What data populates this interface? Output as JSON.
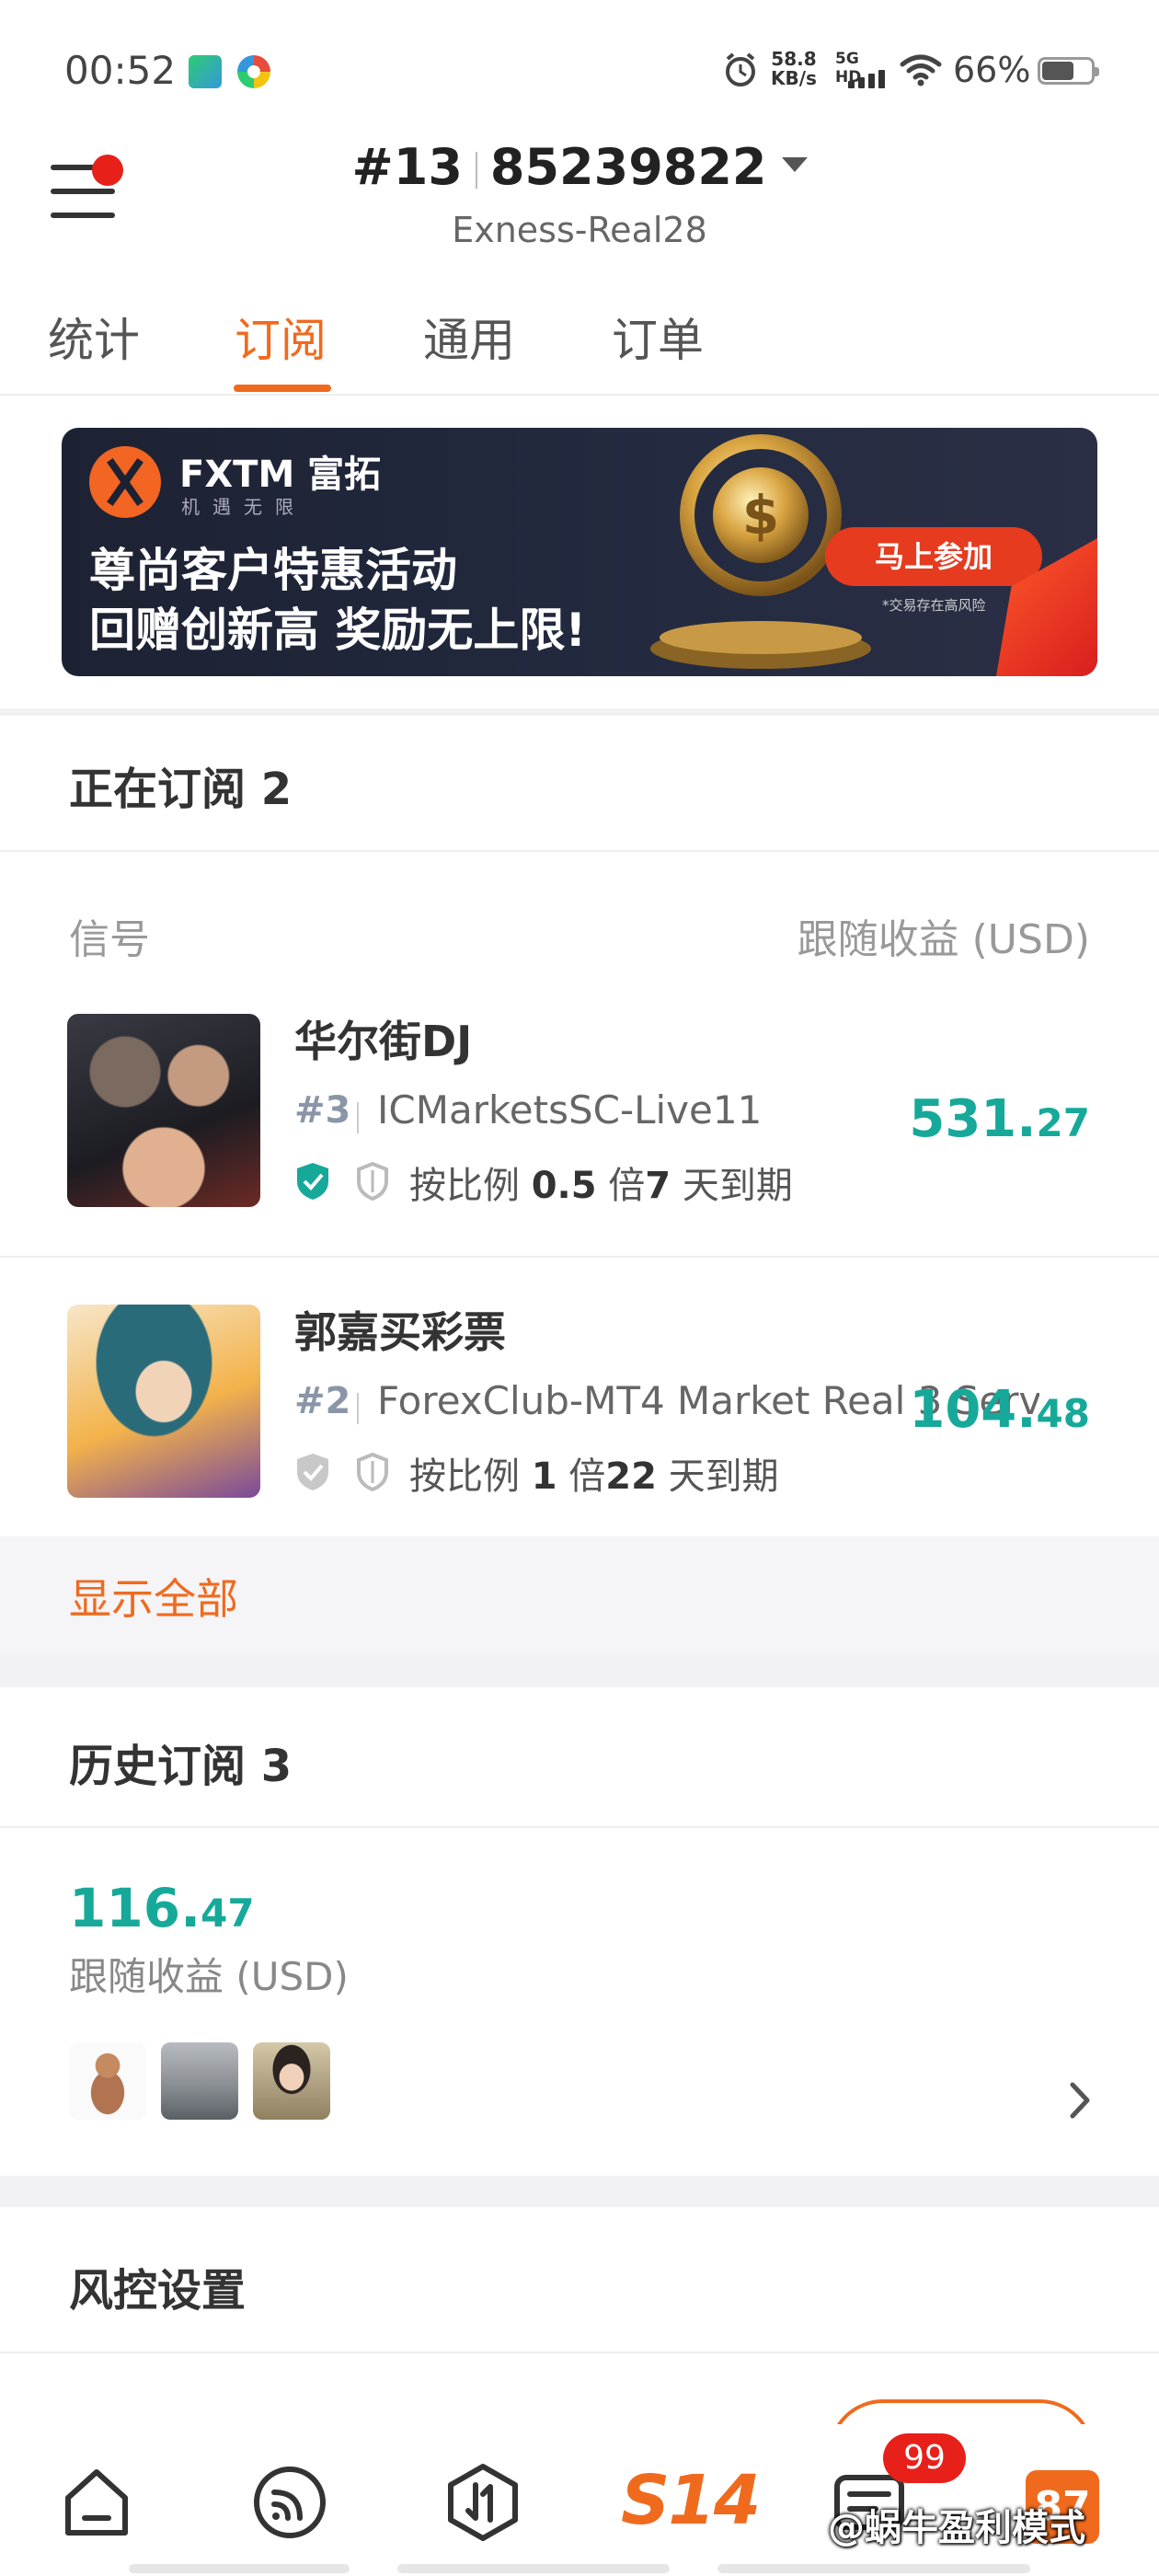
{
  "status_bar": {
    "time": "00:52",
    "net_speed_value": "58.8",
    "net_speed_unit": "KB/s",
    "network_type": "5G HD",
    "battery": "66%"
  },
  "header": {
    "account_rank": "#13",
    "account_number": "85239822",
    "server": "Exness-Real28"
  },
  "tabs": [
    {
      "label": "统计",
      "active": false
    },
    {
      "label": "订阅",
      "active": true
    },
    {
      "label": "通用",
      "active": false
    },
    {
      "label": "订单",
      "active": false
    }
  ],
  "banner": {
    "brand": "FXTM 富拓",
    "slogan": "机遇无限",
    "line1": "尊尚客户特惠活动",
    "line2": "回赠创新高 奖励无上限!",
    "cta": "马上参加",
    "risk_note": "*交易存在高风险"
  },
  "current_subscriptions": {
    "title": "正在订阅 2",
    "col_signal": "信号",
    "col_profit": "跟随收益 (USD)",
    "items": [
      {
        "name": "华尔街DJ",
        "rank": "#3",
        "broker": "ICMarketsSC-Live11",
        "profit_int": "531.",
        "profit_dec": "27",
        "ratio_prefix": "按比例 ",
        "ratio_value": "0.5",
        "ratio_suffix": " 倍",
        "days": "7",
        "days_suffix": " 天到期",
        "verified": true
      },
      {
        "name": "郭嘉买彩票",
        "rank": "#2",
        "broker": "ForexClub-MT4 Market Real 3 Server",
        "profit_int": "104.",
        "profit_dec": "48",
        "ratio_prefix": "按比例 ",
        "ratio_value": "1",
        "ratio_suffix": " 倍",
        "days": "22",
        "days_suffix": " 天到期",
        "verified": false
      }
    ],
    "show_all": "显示全部"
  },
  "history": {
    "title": "历史订阅 3",
    "profit_int": "116.",
    "profit_dec": "47",
    "profit_label": "跟随收益 (USD)"
  },
  "risk_settings": {
    "title": "风控设置"
  },
  "bottom_nav": {
    "s14_label": "S14",
    "badge": "99",
    "tile_label": "87"
  },
  "watermark": "@蜗牛盈利模式",
  "colors": {
    "accent": "#f06a1e",
    "profit": "#16a99a",
    "badge": "#e8201a"
  }
}
